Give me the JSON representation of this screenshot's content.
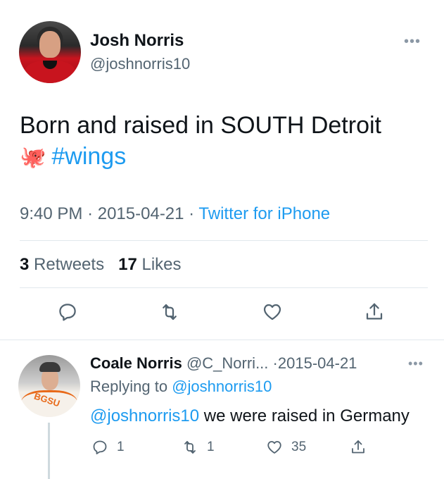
{
  "tweet": {
    "author_name": "Josh Norris",
    "author_handle": "@joshnorris10",
    "text_line1": "Born and raised in SOUTH Detroit",
    "emoji": "🐙",
    "hashtag": "#wings",
    "time": "9:40 PM",
    "sep1": "·",
    "date": "2015-04-21",
    "sep2": "·",
    "source": "Twitter for iPhone",
    "retweets_count": "3",
    "retweets_label": "Retweets",
    "likes_count": "17",
    "likes_label": "Likes",
    "more_icon": "more-dots-icon",
    "actions": [
      "reply-icon",
      "retweet-icon",
      "like-icon",
      "share-icon"
    ]
  },
  "reply": {
    "author_name": "Coale Norris",
    "author_handle": "@C_Norri...",
    "sep": "·",
    "date": "2015-04-21",
    "replying_prefix": "Replying to",
    "replying_to": "@joshnorris10",
    "mention": "@joshnorris10",
    "text": "we were raised in Germany",
    "reply_count": "1",
    "retweet_count": "1",
    "like_count": "35"
  },
  "colors": {
    "link": "#1d9bf0",
    "secondary_text": "#536471",
    "primary_text": "#0f1419",
    "divider": "#e1e8ed"
  }
}
